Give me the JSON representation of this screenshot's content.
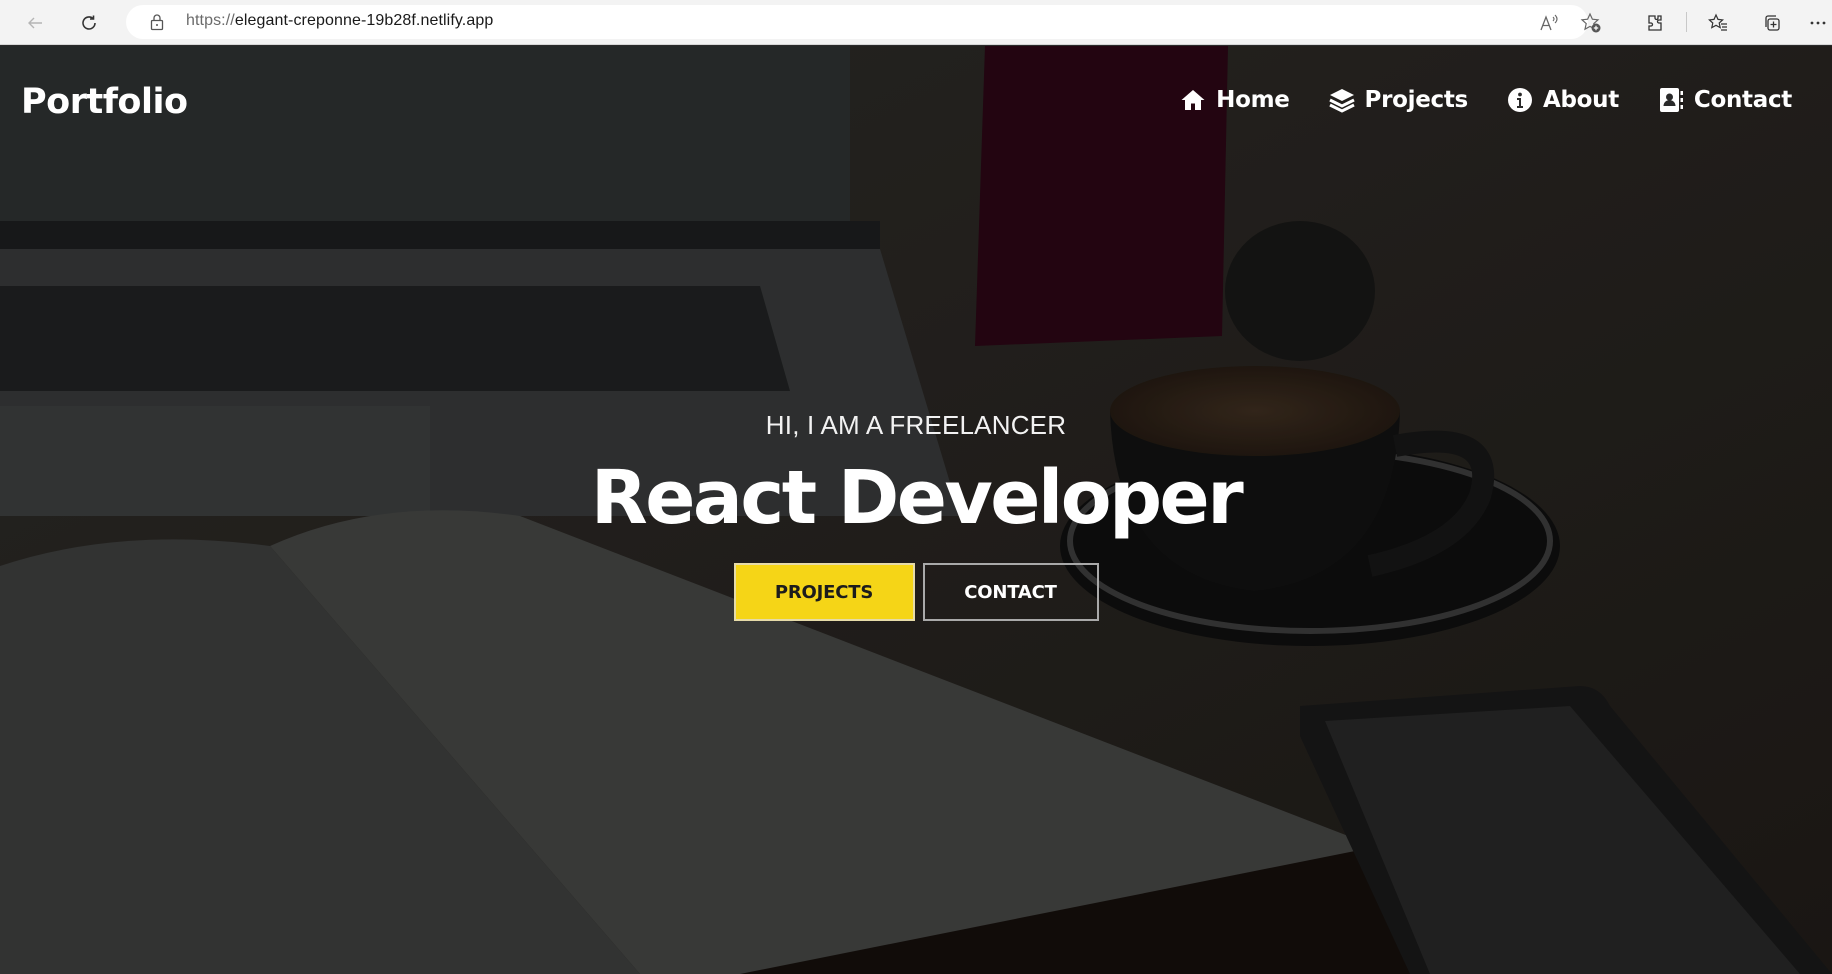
{
  "browser": {
    "url_scheme": "https://",
    "url_host": "elegant-creponne-19b28f.netlify.app",
    "icons": [
      "back-arrow-icon",
      "refresh-icon",
      "lock-icon",
      "read-aloud-icon",
      "add-favorite-icon",
      "extensions-icon",
      "favorites-icon",
      "collections-icon",
      "more-icon"
    ]
  },
  "colors": {
    "accent": "#f5d517",
    "text": "#ffffff",
    "magenta_bottle": "#2a0614"
  },
  "site": {
    "logo": "Portfolio",
    "nav": [
      {
        "label": "Home",
        "icon": "home-icon"
      },
      {
        "label": "Projects",
        "icon": "layers-icon"
      },
      {
        "label": "About",
        "icon": "info-icon"
      },
      {
        "label": "Contact",
        "icon": "address-book-icon"
      }
    ]
  },
  "hero": {
    "subtitle": "HI, I AM A FREELANCER",
    "title": "React Developer",
    "buttons": {
      "projects": "PROJECTS",
      "contact": "CONTACT"
    }
  }
}
